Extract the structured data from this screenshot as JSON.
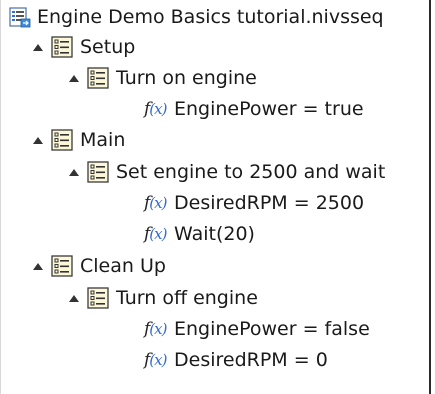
{
  "tree": {
    "root": {
      "label": "Engine Demo Basics tutorial.nivsseq",
      "icon": "sequence-file-icon"
    },
    "groups": [
      {
        "label": "Setup",
        "step": {
          "label": "Turn on engine",
          "expressions": [
            "EnginePower = true"
          ]
        }
      },
      {
        "label": "Main",
        "step": {
          "label": "Set engine to 2500 and wait",
          "expressions": [
            "DesiredRPM = 2500",
            "Wait(20)"
          ]
        }
      },
      {
        "label": "Clean Up",
        "step": {
          "label": "Turn off engine",
          "expressions": [
            "EnginePower = false",
            "DesiredRPM = 0"
          ]
        }
      }
    ]
  }
}
